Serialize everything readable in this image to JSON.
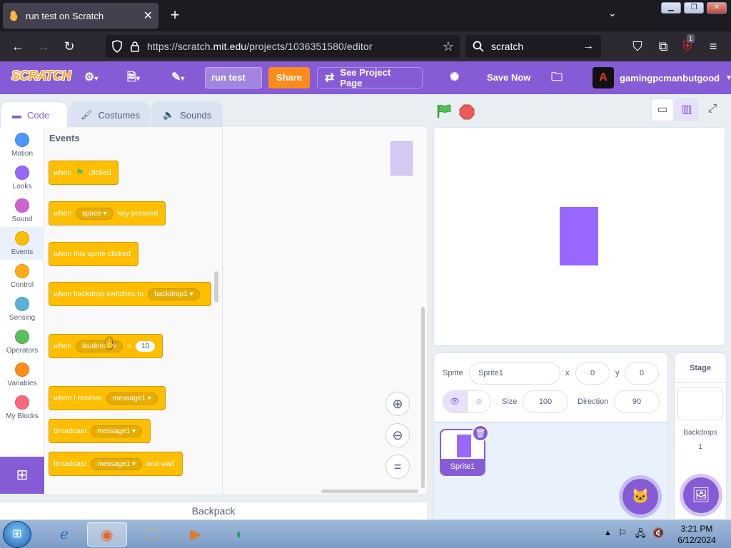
{
  "browser": {
    "tab_title": "run test on Scratch",
    "new_tab": "+",
    "url_prefix": "https://scratch.",
    "url_domain": "mit.edu",
    "url_suffix": "/projects/1036351580/editor",
    "search_text": "scratch",
    "extension_badge": "1"
  },
  "menubar": {
    "logo": "SCRATCH",
    "project_title": "run test",
    "share": "Share",
    "see_project_page": "See Project Page",
    "save_now": "Save Now",
    "username": "gamingpcmanbutgood"
  },
  "tabs": [
    {
      "label": "Code",
      "icon": "code-icon"
    },
    {
      "label": "Costumes",
      "icon": "brush-icon"
    },
    {
      "label": "Sounds",
      "icon": "speaker-icon"
    }
  ],
  "categories": [
    {
      "label": "Motion",
      "color": "#4c97ff"
    },
    {
      "label": "Looks",
      "color": "#9966ff"
    },
    {
      "label": "Sound",
      "color": "#cf63cf"
    },
    {
      "label": "Events",
      "color": "#ffbf00"
    },
    {
      "label": "Control",
      "color": "#ffab19"
    },
    {
      "label": "Sensing",
      "color": "#5cb1d6"
    },
    {
      "label": "Operators",
      "color": "#59c059"
    },
    {
      "label": "Variables",
      "color": "#ff8c1a"
    },
    {
      "label": "My Blocks",
      "color": "#ff6680"
    }
  ],
  "flyout": {
    "heading": "Events",
    "blocks": {
      "flag_when": "when",
      "flag_clicked": "clicked",
      "key_when": "when",
      "key_option": "space",
      "key_pressed": "key pressed",
      "sprite_clicked": "when this sprite clicked",
      "backdrop_when": "when backdrop switches to",
      "backdrop_option": "backdrop1",
      "loud_when": "when",
      "loud_option": "loudness",
      "loud_op": ">",
      "loud_value": "10",
      "receive_label": "when I receive",
      "receive_option": "message1",
      "broadcast_label": "broadcast",
      "broadcast_option": "message1",
      "broadcastwait_label": "broadcast",
      "broadcastwait_option": "message1",
      "broadcastwait_suffix": "and wait"
    }
  },
  "zoom": {
    "zoom_in": "+",
    "zoom_out": "−",
    "reset": "="
  },
  "backpack": "Backpack",
  "sprite": {
    "label_sprite": "Sprite",
    "name": "Sprite1",
    "label_x": "x",
    "x": "0",
    "label_y": "y",
    "y": "0",
    "label_size": "Size",
    "size": "100",
    "label_direction": "Direction",
    "direction": "90",
    "thumb_name": "Sprite1",
    "color": "#9966ff"
  },
  "stage_pane": {
    "header": "Stage",
    "backdrops_label": "Backdrops",
    "backdrops_count": "1"
  },
  "taskbar": {
    "time": "3:21 PM",
    "date": "6/12/2024"
  }
}
